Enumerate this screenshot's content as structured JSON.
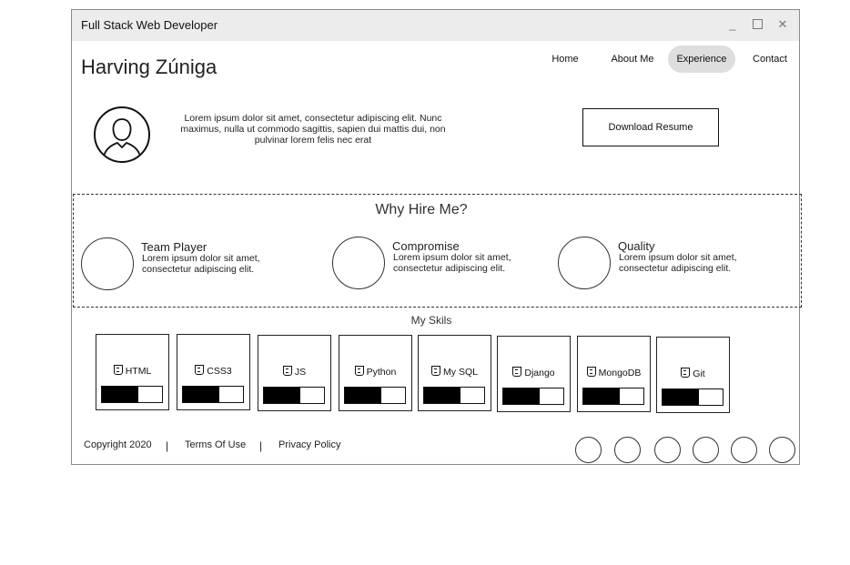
{
  "window": {
    "title": "Full Stack Web Developer",
    "controls": [
      "minimize-icon",
      "maximize-icon",
      "close-icon"
    ]
  },
  "header": {
    "name": "Harving Zúniga",
    "nav": [
      {
        "label": "Home",
        "active": false
      },
      {
        "label": "About Me",
        "active": false
      },
      {
        "label": "Experience",
        "active": true
      },
      {
        "label": "Contact",
        "active": false
      }
    ]
  },
  "intro": {
    "avatar_icon": "user-icon",
    "text": "Lorem ipsum dolor sit amet, consectetur adipiscing elit. Nunc maximus, nulla ut commodo sagittis, sapien dui mattis dui, non pulvinar lorem felis nec erat",
    "download_label": "Download Resume"
  },
  "why": {
    "title": "Why Hire Me?",
    "features": [
      {
        "title": "Team Player",
        "desc": "Lorem ipsum dolor sit amet, consectetur adipiscing elit."
      },
      {
        "title": "Compromise",
        "desc": "Lorem ipsum dolor sit amet, consectetur adipiscing elit."
      },
      {
        "title": "Quality",
        "desc": "Lorem ipsum dolor sit amet, consectetur adipiscing elit."
      }
    ]
  },
  "skills": {
    "title": "My Skils",
    "items": [
      {
        "name": "HTML",
        "level": 0.6
      },
      {
        "name": "CSS3",
        "level": 0.6
      },
      {
        "name": "JS",
        "level": 0.6
      },
      {
        "name": "Python",
        "level": 0.6
      },
      {
        "name": "My SQL",
        "level": 0.6
      },
      {
        "name": "Django",
        "level": 0.6
      },
      {
        "name": "MongoDB",
        "level": 0.6
      },
      {
        "name": "Git",
        "level": 0.6
      }
    ]
  },
  "footer": {
    "copyright": "Copyright 2020",
    "separator": "|",
    "terms": "Terms Of Use",
    "privacy": "Privacy Policy",
    "social_count": 6
  }
}
